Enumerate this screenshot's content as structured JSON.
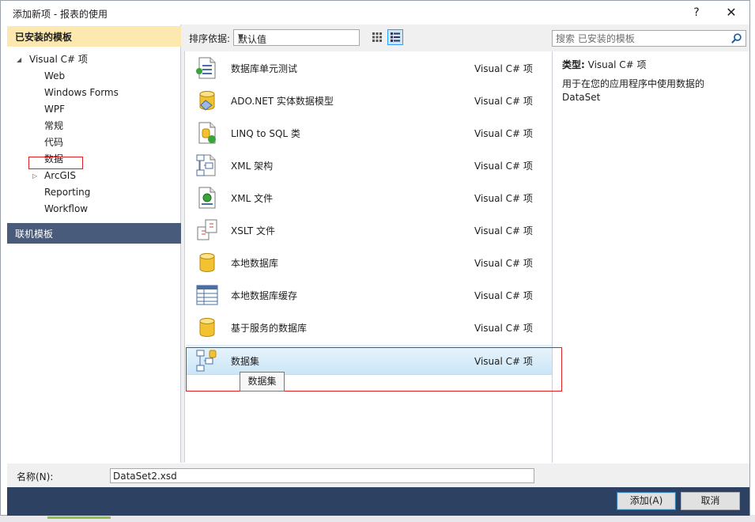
{
  "window": {
    "title": "添加新项 - 报表的使用",
    "help": "?",
    "close": "✕"
  },
  "left": {
    "installed_header": "已安装的模板",
    "tree": [
      {
        "label": "Visual C# 项",
        "level": 0,
        "expander": "◢"
      },
      {
        "label": "Web",
        "level": 1,
        "expander": ""
      },
      {
        "label": "Windows Forms",
        "level": 1,
        "expander": ""
      },
      {
        "label": "WPF",
        "level": 1,
        "expander": ""
      },
      {
        "label": "常规",
        "level": 1,
        "expander": ""
      },
      {
        "label": "代码",
        "level": 1,
        "expander": ""
      },
      {
        "label": "数据",
        "level": 1,
        "expander": ""
      },
      {
        "label": "ArcGIS",
        "level": 1,
        "expander": "▷"
      },
      {
        "label": "Reporting",
        "level": 1,
        "expander": ""
      },
      {
        "label": "Workflow",
        "level": 1,
        "expander": ""
      }
    ],
    "online_header": "联机模板"
  },
  "toolbar": {
    "sort_label": "排序依据:",
    "sort_value": "默认值",
    "view_small_icon": "small-icons-view-icon",
    "view_list_icon": "list-view-icon"
  },
  "search": {
    "placeholder": "搜索 已安装的模板",
    "icon": "search-icon"
  },
  "templates": [
    {
      "name": "数据库单元测试",
      "lang": "Visual C# 项",
      "icon": "unit-test-db-icon",
      "selected": false
    },
    {
      "name": "ADO.NET 实体数据模型",
      "lang": "Visual C# 项",
      "icon": "entity-model-icon",
      "selected": false
    },
    {
      "name": "LINQ to SQL 类",
      "lang": "Visual C# 项",
      "icon": "linq-sql-icon",
      "selected": false
    },
    {
      "name": "XML 架构",
      "lang": "Visual C# 项",
      "icon": "xml-schema-icon",
      "selected": false
    },
    {
      "name": "XML 文件",
      "lang": "Visual C# 项",
      "icon": "xml-file-icon",
      "selected": false
    },
    {
      "name": "XSLT 文件",
      "lang": "Visual C# 项",
      "icon": "xslt-file-icon",
      "selected": false
    },
    {
      "name": "本地数据库",
      "lang": "Visual C# 项",
      "icon": "local-db-icon",
      "selected": false
    },
    {
      "name": "本地数据库缓存",
      "lang": "Visual C# 项",
      "icon": "local-db-cache-icon",
      "selected": false
    },
    {
      "name": "基于服务的数据库",
      "lang": "Visual C# 项",
      "icon": "service-db-icon",
      "selected": false
    },
    {
      "name": "数据集",
      "lang": "Visual C# 项",
      "icon": "dataset-icon",
      "selected": true
    }
  ],
  "tooltip": "数据集",
  "details": {
    "type_label": "类型:",
    "type_value": "Visual C# 项",
    "description": "用于在您的应用程序中使用数据的 DataSet"
  },
  "name_row": {
    "label": "名称(N):",
    "value": "DataSet2.xsd"
  },
  "buttons": {
    "add": "添加(A)",
    "cancel": "取消"
  },
  "colors": {
    "header_selected": "#fde9b0",
    "header_online": "#485b7a",
    "button_bar": "#2d4262",
    "highlight_red": "#e02020"
  }
}
